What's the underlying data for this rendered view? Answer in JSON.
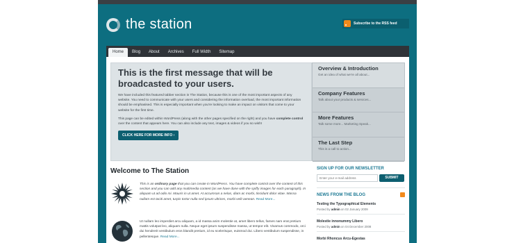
{
  "header": {
    "site_title": "the station",
    "rss_label": "Subscribe to the RSS feed"
  },
  "nav": [
    "Home",
    "Blog",
    "About",
    "Archives",
    "Full Width",
    "Sitemap"
  ],
  "feature": {
    "title": "This is the first message that will be broadcasted to your users.",
    "paragraph1": "We have included this featured tabber section in The Station, because this is one of the most important aspects of any website. You need to communicate with your users and considering the information overload, the most important information should be emphasised. This is especially important when you're looking to make an impact on visitors that come to your website for the first time.",
    "paragraph2_a": "This page can be edited within WordPress (along with the other pages specified on the right) and you have ",
    "paragraph2_b": "complete control",
    "paragraph2_c": " over the content that appears here. You can also include any text, images & videos if you so wish!",
    "cta": "CLICK HERE FOR MORE INFO ›"
  },
  "tabs": [
    {
      "title": "Overview & Introduction",
      "desc": "Get an idea of what we're all about..."
    },
    {
      "title": "Company Features",
      "desc": "Talk about your products & services..."
    },
    {
      "title": "More Features",
      "desc": "Talk some more... Marketing Speak..."
    },
    {
      "title": "The Last Step",
      "desc": "This is a call to action..."
    }
  ],
  "main": {
    "title": "Welcome to The Station",
    "post1_a": "This is an ",
    "post1_b": "ordinary page",
    "post1_c": " that you can create in WordPress. You have complete control over the content of this section and you can add any multimedia content (as we have done with the spiffy images for each paragraph). In aliquam ut ad odio mi. Mauris in ut amet. At accumsan a nelas, diam ac morbi, tincidunt dolor vitae. Massa nullam est taciti amet, turpis tortor nulla sed ipsum ultrices, morbi velit aenean.",
    "post2": "Ut nullam leo imperdiet arcu aliquam, a id massa anim molestie at, amet libero tellus, fames nam erat pretium mattis volutpat leo, aliquam nulla. Neque eget ipsum suspendisse massa, ut tempor elit. Vivamus commodo, orci dui hendrerit vestibulum eros blandit pretium, id eu scelerisque, euismod dui. Libero vestibulum suspendisse, in pellentesque.",
    "read_more": "Read More..."
  },
  "sidebar": {
    "newsletter_title": "SIGN UP FOR OUR NEWSLETTER",
    "email_placeholder": "Enter your e-mail address",
    "submit_label": "SUBMIT",
    "blog_title": "NEWS FROM THE BLOG",
    "posts": [
      {
        "title": "Testing the Typographical Elements",
        "by": "Posted by ",
        "author": "admin",
        "on": " on 02 January 2009"
      },
      {
        "title": "Molestie innonummy Libero",
        "by": "Posted by ",
        "author": "admin",
        "on": " on 04 December 2008"
      },
      {
        "title": "Morbi Rhoncus Arcu-Egestas",
        "by": "",
        "author": "",
        "on": ""
      }
    ]
  },
  "colors": {
    "brand_teal": "#0d6e80",
    "button_teal": "#0d5f70",
    "rss_orange": "#f28a1b",
    "link_blue": "#1b7893"
  }
}
